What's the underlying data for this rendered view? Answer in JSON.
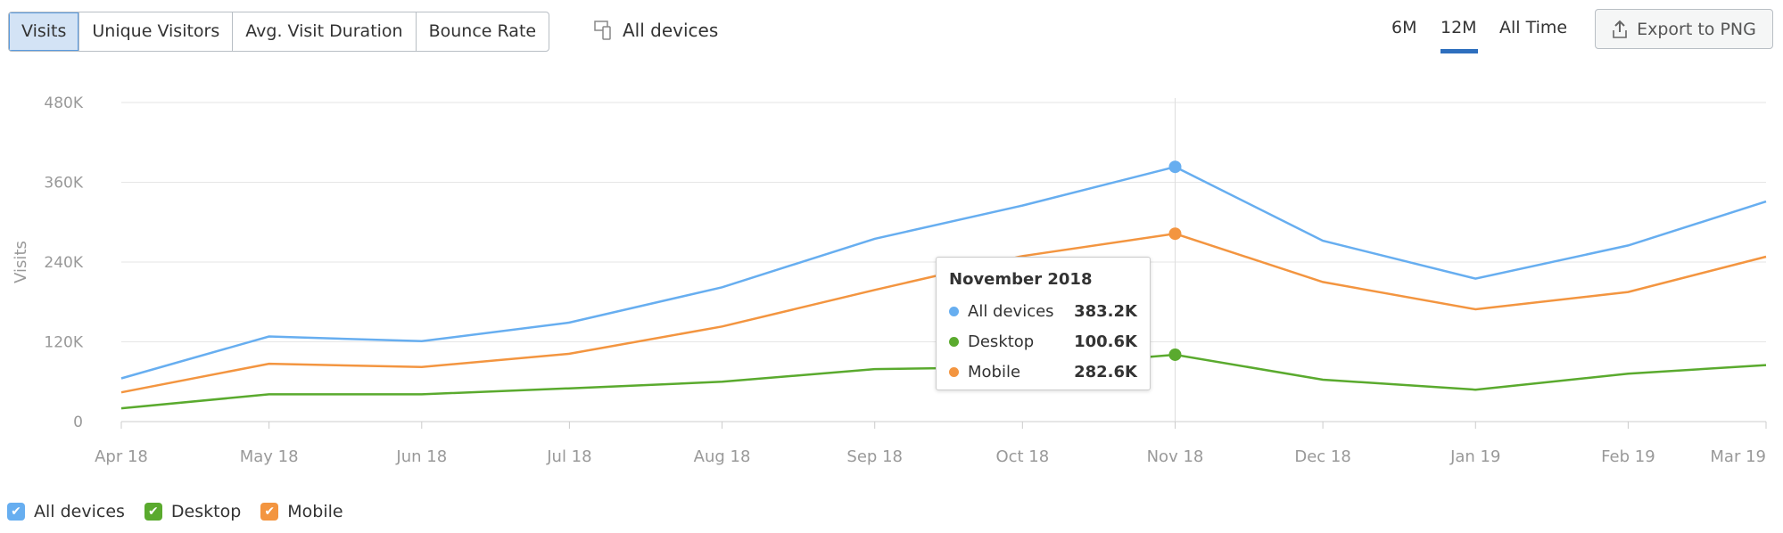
{
  "tabs": [
    {
      "label": "Visits",
      "active": true
    },
    {
      "label": "Unique Visitors"
    },
    {
      "label": "Avg. Visit Duration"
    },
    {
      "label": "Bounce Rate"
    }
  ],
  "device_filter": {
    "label": "All devices",
    "icon": "devices-icon"
  },
  "ranges": [
    {
      "label": "6M"
    },
    {
      "label": "12M",
      "active": true
    },
    {
      "label": "All Time"
    }
  ],
  "export": {
    "label": "Export to PNG",
    "icon": "upload-icon"
  },
  "tooltip": {
    "title": "November 2018",
    "rows": [
      {
        "label": "All devices",
        "value": "383.2K"
      },
      {
        "label": "Desktop",
        "value": "100.6K"
      },
      {
        "label": "Mobile",
        "value": "282.6K"
      }
    ]
  },
  "chart_data": {
    "type": "line",
    "ylabel": "Visits",
    "ylim": [
      0,
      480000
    ],
    "yticks": [
      {
        "v": 0,
        "label": "0"
      },
      {
        "v": 120000,
        "label": "120K"
      },
      {
        "v": 240000,
        "label": "240K"
      },
      {
        "v": 360000,
        "label": "360K"
      },
      {
        "v": 480000,
        "label": "480K"
      }
    ],
    "x": [
      "2018-04-01",
      "2018-05-01",
      "2018-06-01",
      "2018-07-01",
      "2018-08-01",
      "2018-09-01",
      "2018-10-01",
      "2018-11-01",
      "2018-12-01",
      "2019-01-01",
      "2019-02-01",
      "2019-03-01"
    ],
    "xticklabels": [
      "Apr 18",
      "May 18",
      "Jun 18",
      "Jul 18",
      "Aug 18",
      "Sep 18",
      "Oct 18",
      "Nov 18",
      "Dec 18",
      "Jan 19",
      "Feb 19",
      "Mar 19"
    ],
    "grid": true,
    "legend": "bottom-left",
    "highlight_index": 7,
    "series": [
      {
        "name": "All devices",
        "color": "#67aef0",
        "values": [
          65000,
          128000,
          121000,
          149000,
          202000,
          275000,
          325000,
          383200,
          272000,
          215000,
          265000,
          331000
        ]
      },
      {
        "name": "Desktop",
        "color": "#5aaa2e",
        "values": [
          20000,
          41000,
          41000,
          50000,
          60000,
          79000,
          82000,
          100600,
          63000,
          48000,
          72000,
          85000
        ]
      },
      {
        "name": "Mobile",
        "color": "#f39540",
        "values": [
          44000,
          87000,
          82000,
          102000,
          143000,
          198000,
          249000,
          282600,
          210000,
          169000,
          195000,
          248000
        ]
      }
    ]
  }
}
